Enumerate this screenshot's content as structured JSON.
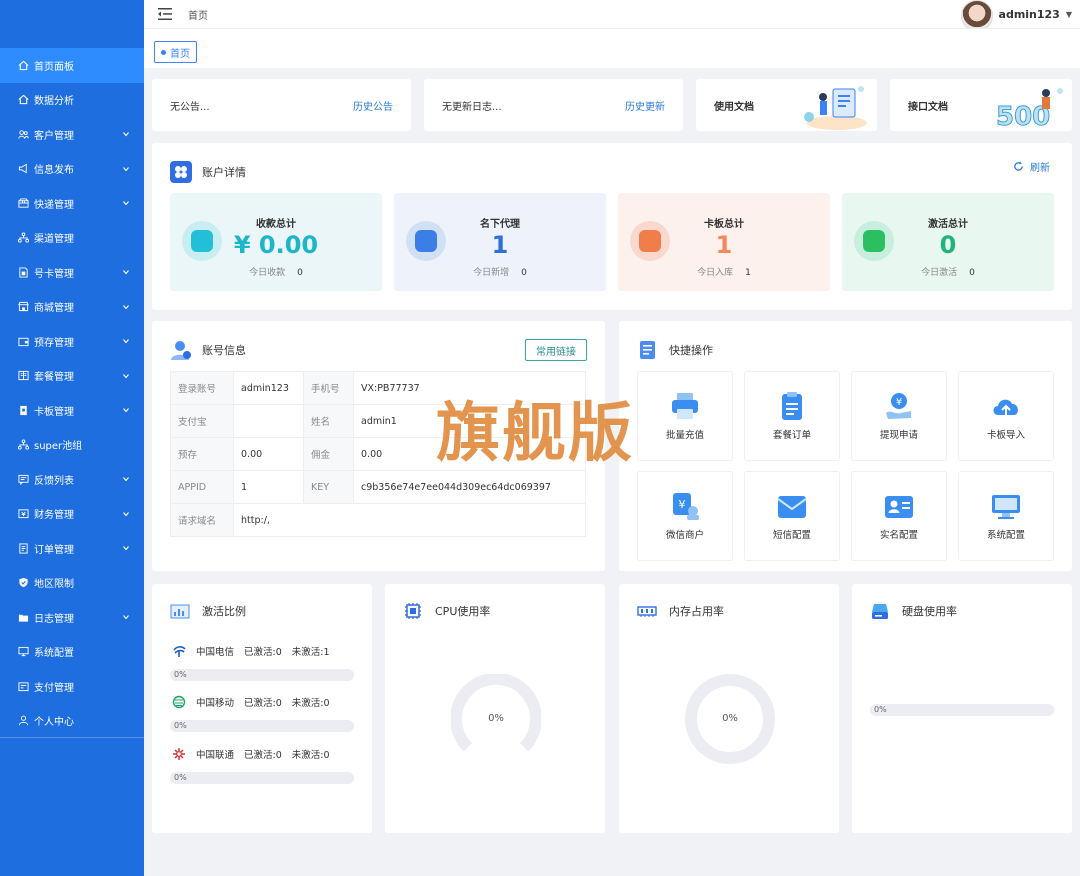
{
  "sidebar": {
    "items": [
      {
        "label": "首页面板",
        "icon": "home-icon",
        "active": true,
        "expandable": false
      },
      {
        "label": "数据分析",
        "icon": "home-icon",
        "active": false,
        "expandable": false
      },
      {
        "label": "客户管理",
        "icon": "user-group-icon",
        "active": false,
        "expandable": true
      },
      {
        "label": "信息发布",
        "icon": "megaphone-icon",
        "active": false,
        "expandable": true
      },
      {
        "label": "快递管理",
        "icon": "box-icon",
        "active": false,
        "expandable": true
      },
      {
        "label": "渠道管理",
        "icon": "network-icon",
        "active": false,
        "expandable": false
      },
      {
        "label": "号卡管理",
        "icon": "sim-card-icon",
        "active": false,
        "expandable": true
      },
      {
        "label": "商城管理",
        "icon": "shop-icon",
        "active": false,
        "expandable": true
      },
      {
        "label": "预存管理",
        "icon": "wallet-icon",
        "active": false,
        "expandable": true
      },
      {
        "label": "套餐管理",
        "icon": "package-icon",
        "active": false,
        "expandable": true
      },
      {
        "label": "卡板管理",
        "icon": "card-icon",
        "active": false,
        "expandable": true
      },
      {
        "label": "super池组",
        "icon": "network-icon",
        "active": false,
        "expandable": false
      },
      {
        "label": "反馈列表",
        "icon": "feedback-icon",
        "active": false,
        "expandable": true
      },
      {
        "label": "财务管理",
        "icon": "finance-icon",
        "active": false,
        "expandable": true
      },
      {
        "label": "订单管理",
        "icon": "order-icon",
        "active": false,
        "expandable": true
      },
      {
        "label": "地区限制",
        "icon": "shield-icon",
        "active": false,
        "expandable": false
      },
      {
        "label": "日志管理",
        "icon": "folder-icon",
        "active": false,
        "expandable": true
      },
      {
        "label": "系统配置",
        "icon": "monitor-icon",
        "active": false,
        "expandable": false
      },
      {
        "label": "支付管理",
        "icon": "pay-icon",
        "active": false,
        "expandable": false
      },
      {
        "label": "个人中心",
        "icon": "person-icon",
        "active": false,
        "expandable": false
      }
    ]
  },
  "topbar": {
    "breadcrumb": "首页",
    "username": "admin123"
  },
  "tabs": [
    {
      "label": "首页"
    }
  ],
  "notices": {
    "announcement": {
      "text": "无公告...",
      "link": "历史公告"
    },
    "changelog": {
      "text": "无更新日志...",
      "link": "历史更新"
    },
    "docs": {
      "label": "使用文档"
    },
    "api_docs": {
      "label": "接口文档"
    }
  },
  "account_detail": {
    "title": "账户详情",
    "refresh": "刷新",
    "stats": [
      {
        "label": "收款总计",
        "value": "¥ 0.00",
        "sub_label": "今日收款",
        "sub_value": "0",
        "color": "#1fb5c9",
        "bg": "#eaf6f7",
        "circle": "#c9eef2",
        "inner": "#22c0d6"
      },
      {
        "label": "名下代理",
        "value": "1",
        "sub_label": "今日新增",
        "sub_value": "0",
        "color": "#2e6fd8",
        "bg": "#eef3fb",
        "circle": "#d2e0f6",
        "inner": "#3a7ee6"
      },
      {
        "label": "卡板总计",
        "value": "1",
        "sub_label": "今日入库",
        "sub_value": "1",
        "color": "#f08a5d",
        "bg": "#fdf1ee",
        "circle": "#fad8cd",
        "inner": "#f07e4a"
      },
      {
        "label": "激活总计",
        "value": "0",
        "sub_label": "今日激活",
        "sub_value": "0",
        "color": "#1fb57a",
        "bg": "#e9f7f1",
        "circle": "#c8eedd",
        "inner": "#2cbf62"
      }
    ]
  },
  "account_info": {
    "title": "账号信息",
    "button": "常用链接",
    "rows": [
      {
        "k1": "登录账号",
        "v1": "admin123",
        "k2": "手机号",
        "v2": "VX:PB77737"
      },
      {
        "k1": "支付宝",
        "v1": "",
        "k2": "姓名",
        "v2": "admin1"
      },
      {
        "k1": "预存",
        "v1": "0.00",
        "k2": "佣金",
        "v2": "0.00"
      },
      {
        "k1": "APPID",
        "v1": "1",
        "k2": "KEY",
        "v2": "c9b356e74e7ee044d309ec64dc069397"
      },
      {
        "k1": "请求域名",
        "v1": "http:/,"
      }
    ]
  },
  "watermark": "旗舰版",
  "quick_ops": {
    "title": "快捷操作",
    "items": [
      {
        "label": "批量充值",
        "icon": "printer-icon"
      },
      {
        "label": "套餐订单",
        "icon": "clipboard-icon"
      },
      {
        "label": "提现申请",
        "icon": "withdraw-icon"
      },
      {
        "label": "卡板导入",
        "icon": "cloud-upload-icon"
      },
      {
        "label": "微信商户",
        "icon": "merchant-icon"
      },
      {
        "label": "短信配置",
        "icon": "envelope-icon"
      },
      {
        "label": "实名配置",
        "icon": "id-card-icon"
      },
      {
        "label": "系统配置",
        "icon": "monitor-icon"
      }
    ]
  },
  "activation": {
    "title": "激活比例",
    "operators": [
      {
        "name": "中国电信",
        "activated": "已激活:0",
        "inactive": "未激活:1",
        "percent": "0%",
        "fill": 0
      },
      {
        "name": "中国移动",
        "activated": "已激活:0",
        "inactive": "未激活:0",
        "percent": "0%",
        "fill": 0
      },
      {
        "name": "中国联通",
        "activated": "已激活:0",
        "inactive": "未激活:0",
        "percent": "0%",
        "fill": 0
      }
    ]
  },
  "cpu": {
    "title": "CPU使用率",
    "value": "0%",
    "fill": 0
  },
  "memory": {
    "title": "内存占用率",
    "value": "0%",
    "fill": 0
  },
  "disk": {
    "title": "硬盘使用率",
    "value": "0%",
    "fill": 0
  }
}
